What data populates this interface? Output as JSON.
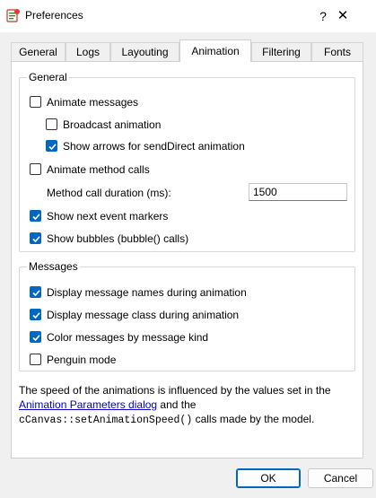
{
  "window": {
    "title": "Preferences",
    "help_glyph": "?",
    "close_glyph": "✕"
  },
  "tabs": [
    {
      "label": "General",
      "active": false
    },
    {
      "label": "Logs",
      "active": false
    },
    {
      "label": "Layouting",
      "active": false
    },
    {
      "label": "Animation",
      "active": true
    },
    {
      "label": "Filtering",
      "active": false
    },
    {
      "label": "Fonts",
      "active": false
    }
  ],
  "general_group": {
    "title": "General",
    "animate_messages": {
      "label": "Animate messages",
      "checked": false
    },
    "broadcast_animation": {
      "label": "Broadcast animation",
      "checked": false
    },
    "show_arrows": {
      "label": "Show arrows for sendDirect animation",
      "checked": true
    },
    "animate_method_calls": {
      "label": "Animate method calls",
      "checked": false
    },
    "method_call_duration": {
      "label": "Method call duration (ms):",
      "value": "1500"
    },
    "show_next_event_markers": {
      "label": "Show next event markers",
      "checked": true
    },
    "show_bubbles": {
      "label": "Show bubbles (bubble() calls)",
      "checked": true
    }
  },
  "messages_group": {
    "title": "Messages",
    "display_names": {
      "label": "Display message names during animation",
      "checked": true
    },
    "display_class": {
      "label": "Display message class during animation",
      "checked": true
    },
    "color_by_kind": {
      "label": "Color messages by message kind",
      "checked": true
    },
    "penguin_mode": {
      "label": "Penguin mode",
      "checked": false
    }
  },
  "info": {
    "text1": "The speed of the animations is influenced by the values set in the",
    "link": "Animation Parameters dialog",
    "text2": " and the",
    "code": "cCanvas::setAnimationSpeed()",
    "text3": " calls made by the model."
  },
  "buttons": {
    "ok": "OK",
    "cancel": "Cancel"
  },
  "colors": {
    "accent": "#0067c0",
    "link": "#0000cc"
  }
}
